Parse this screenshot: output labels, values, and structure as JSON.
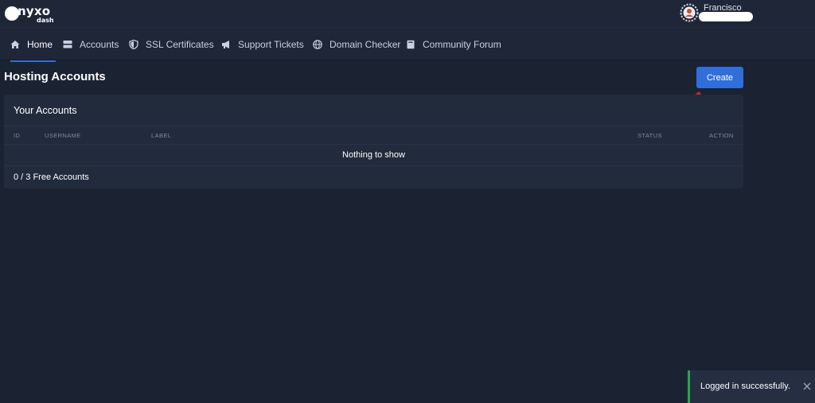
{
  "brand": {
    "name": "nyxo",
    "sub": "dash"
  },
  "user": {
    "name": "Francisco"
  },
  "nav": [
    {
      "label": "Home",
      "icon": "home-icon",
      "active": true
    },
    {
      "label": "Accounts",
      "icon": "server-icon"
    },
    {
      "label": "SSL Certificates",
      "icon": "shield-icon"
    },
    {
      "label": "Support Tickets",
      "icon": "megaphone-icon"
    },
    {
      "label": "Domain Checker",
      "icon": "globe-icon"
    },
    {
      "label": "Community Forum",
      "icon": "book-icon"
    }
  ],
  "page": {
    "title": "Hosting Accounts",
    "create_label": "Create"
  },
  "card": {
    "title": "Your Accounts",
    "columns": [
      "ID",
      "USERNAME",
      "LABEL",
      "STATUS",
      "ACTION"
    ],
    "empty_text": "Nothing to show",
    "footer": "0 / 3 Free Accounts"
  },
  "toast": {
    "message": "Logged in successfully."
  },
  "colors": {
    "accent": "#2f6fdc",
    "success": "#2ea44f",
    "background": "#1b2232",
    "annotation": "#e02020"
  }
}
